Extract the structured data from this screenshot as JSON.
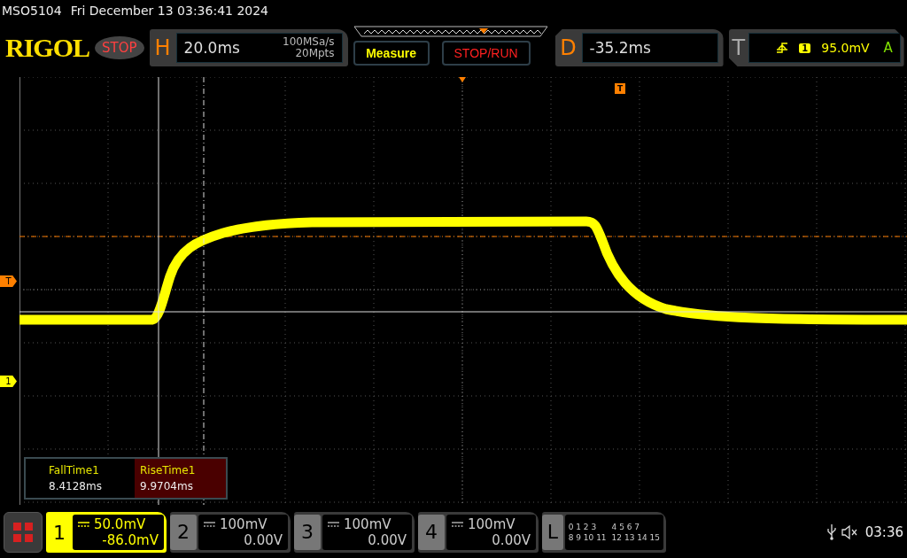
{
  "status_bar": {
    "model": "MSO5104",
    "datetime": "Fri December 13 03:36:41 2024"
  },
  "toolbar": {
    "brand": "RIGOL",
    "run_state": "STOP",
    "horizontal": {
      "label": "H",
      "timebase": "20.0ms",
      "sample_rate": "100MSa/s",
      "memory_depth": "20Mpts"
    },
    "buttons": [
      "Measure",
      "STOP/RUN"
    ],
    "delay": {
      "label": "D",
      "value": "-35.2ms"
    },
    "trigger": {
      "label": "T",
      "source": "1",
      "level": "95.0mV",
      "mode": "A"
    }
  },
  "waveform": {
    "trigger_level_marker": "T",
    "channel_marker": "1",
    "trigger_position_marker": "T"
  },
  "measurements": [
    {
      "name": "FallTime1",
      "value": "8.4128ms",
      "selected": false
    },
    {
      "name": "RiseTime1",
      "value": "9.9704ms",
      "selected": true
    }
  ],
  "channels": [
    {
      "number": "1",
      "scale": "50.0mV",
      "offset": "-86.0mV",
      "selected": true
    },
    {
      "number": "2",
      "scale": "100mV",
      "offset": "0.00V",
      "selected": false
    },
    {
      "number": "3",
      "scale": "100mV",
      "offset": "0.00V",
      "selected": false
    },
    {
      "number": "4",
      "scale": "100mV",
      "offset": "0.00V",
      "selected": false
    }
  ],
  "logic": {
    "label": "L",
    "groups": [
      "0 1 2 3",
      "4 5 6 7",
      "8 9 10 11",
      "12 13 14 15"
    ]
  },
  "clock": "03:36"
}
